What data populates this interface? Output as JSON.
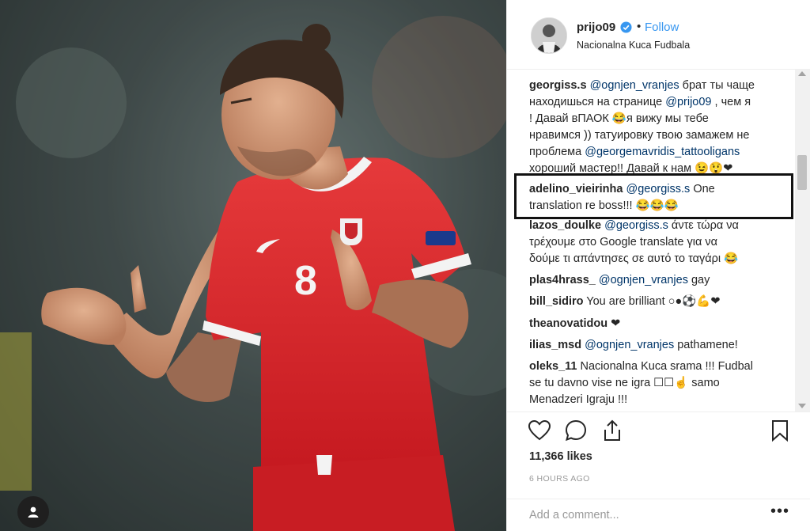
{
  "post": {
    "username": "prijo09",
    "verified_icon": "verified-badge-icon",
    "dot": "•",
    "follow_label": "Follow",
    "location": "Nacionalna Kuca Fudbala"
  },
  "photo": {
    "jersey_number": "8",
    "sponsor_icon": "puma-logo",
    "badge_icon": "serbia-crest",
    "user_tag_icon": "person-icon"
  },
  "comments": [
    {
      "user": "georgiss.s",
      "lines": [
        {
          "parts": [
            {
              "t": "@ognjen_vranjes",
              "m": true
            },
            {
              "t": " брат ты чаще"
            }
          ]
        },
        {
          "parts": [
            {
              "t": "находишься на странице "
            },
            {
              "t": "@prijo09",
              "m": true
            },
            {
              "t": " , чем я"
            }
          ]
        },
        {
          "parts": [
            {
              "t": "! Давай вПАОК 😂я вижу мы тебе"
            }
          ]
        },
        {
          "parts": [
            {
              "t": "нравимся )) татуировку твою замажем не"
            }
          ]
        },
        {
          "parts": [
            {
              "t": "проблема "
            },
            {
              "t": "@georgemavridis_tattooligans",
              "m": true
            }
          ]
        },
        {
          "parts": [
            {
              "t": "хороший мастер!! Давай к нам 😉😲❤"
            }
          ]
        }
      ]
    },
    {
      "user": "adelino_vieirinha",
      "lines": [
        {
          "parts": [
            {
              "t": "@georgiss.s",
              "m": true
            },
            {
              "t": " One"
            }
          ]
        },
        {
          "parts": [
            {
              "t": "translation re boss!!! 😂😂😂"
            }
          ]
        }
      ]
    },
    {
      "user": "lazos_doulke",
      "lines": [
        {
          "parts": [
            {
              "t": "@georgiss.s",
              "m": true
            },
            {
              "t": " άντε τώρα να"
            }
          ]
        },
        {
          "parts": [
            {
              "t": "τρέχουμε στο Google translate για να"
            }
          ]
        },
        {
          "parts": [
            {
              "t": "δούμε τι απάντησες σε αυτό το ταγάρι 😂"
            }
          ]
        }
      ]
    },
    {
      "user": "plas4hrass_",
      "lines": [
        {
          "parts": [
            {
              "t": "@ognjen_vranjes",
              "m": true
            },
            {
              "t": " gay"
            }
          ]
        }
      ]
    },
    {
      "user": "bill_sidiro",
      "lines": [
        {
          "parts": [
            {
              "t": "You are brilliant ○●⚽💪❤"
            }
          ]
        }
      ]
    },
    {
      "user": "theanovatidou",
      "lines": [
        {
          "parts": [
            {
              "t": "❤"
            }
          ]
        }
      ]
    },
    {
      "user": "ilias_msd",
      "lines": [
        {
          "parts": [
            {
              "t": "@ognjen_vranjes",
              "m": true
            },
            {
              "t": " pathamene!"
            }
          ]
        }
      ]
    },
    {
      "user": "oleks_11",
      "lines": [
        {
          "parts": [
            {
              "t": "Nacionalna Kuca srama !!! Fudbal"
            }
          ]
        },
        {
          "parts": [
            {
              "t": "se tu davno vise ne igra ☐☐☝ samo"
            }
          ]
        },
        {
          "parts": [
            {
              "t": "Menadzeri Igraju !!!"
            }
          ]
        }
      ]
    }
  ],
  "actions": {
    "like_icon": "heart-icon",
    "comment_icon": "comment-bubble-icon",
    "share_icon": "share-icon",
    "save_icon": "bookmark-icon"
  },
  "likes_text": "11,366 likes",
  "timestamp": "6 HOURS AGO",
  "add_comment": {
    "placeholder": "Add a comment...",
    "more_label": "•••"
  },
  "colors": {
    "mention": "#003569",
    "follow": "#3897f0",
    "jersey": "#d6262b",
    "highlight_border": "#111111"
  }
}
